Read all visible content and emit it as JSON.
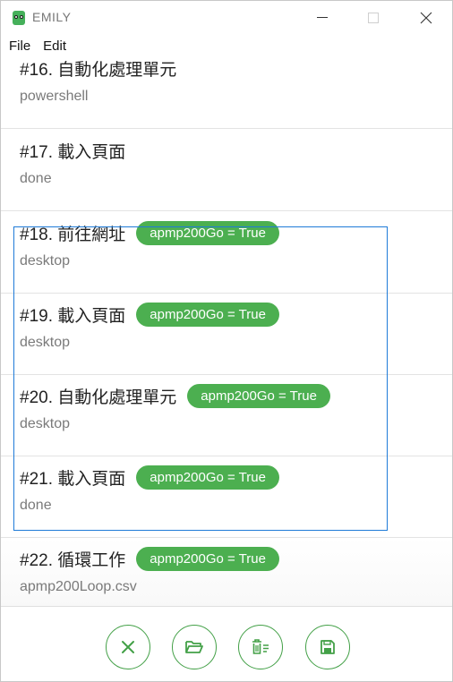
{
  "window": {
    "title": "EMILY"
  },
  "menu": [
    {
      "label": "File"
    },
    {
      "label": "Edit"
    }
  ],
  "tasks": [
    {
      "title": "#16. 自動化處理單元",
      "sub": "powershell",
      "tag": ""
    },
    {
      "title": "#17. 載入頁面",
      "sub": "done",
      "tag": ""
    },
    {
      "title": "#18. 前往網址",
      "sub": "desktop",
      "tag": "apmp200Go = True"
    },
    {
      "title": "#19. 載入頁面",
      "sub": "desktop",
      "tag": "apmp200Go = True"
    },
    {
      "title": "#20. 自動化處理單元",
      "sub": "desktop",
      "tag": "apmp200Go = True"
    },
    {
      "title": "#21. 載入頁面",
      "sub": "done",
      "tag": "apmp200Go = True"
    },
    {
      "title": "#22. 循環工作",
      "sub": "apmp200Loop.csv",
      "tag": "apmp200Go = True"
    }
  ],
  "colors": {
    "accent": "#4caf50",
    "selection": "#1f7bd8"
  },
  "footer": {
    "buttons": [
      "close-icon",
      "folder-open-icon",
      "delete-list-icon",
      "save-icon"
    ]
  }
}
